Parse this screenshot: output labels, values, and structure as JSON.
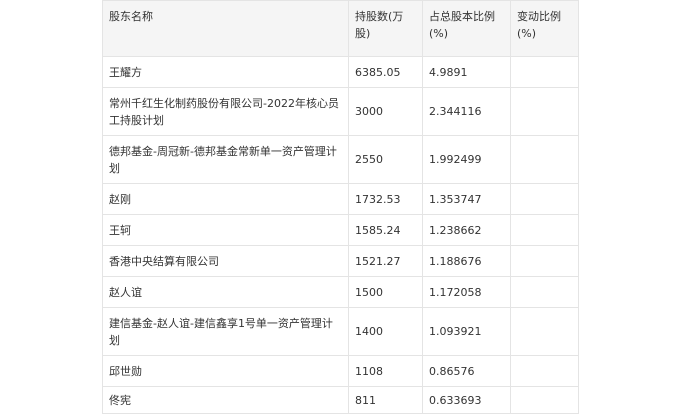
{
  "table": {
    "headers": [
      "股东名称",
      "持股数(万股)",
      "占总股本比例(%)",
      "变动比例(%)"
    ],
    "rows": [
      {
        "name": "王耀方",
        "shares": "6385.05",
        "ratio": "4.9891",
        "change": ""
      },
      {
        "name": "常州千红生化制药股份有限公司-2022年核心员工持股计划",
        "shares": "3000",
        "ratio": "2.344116",
        "change": ""
      },
      {
        "name": "德邦基金-周冠新-德邦基金常新单一资产管理计划",
        "shares": "2550",
        "ratio": "1.992499",
        "change": ""
      },
      {
        "name": "赵刚",
        "shares": "1732.53",
        "ratio": "1.353747",
        "change": ""
      },
      {
        "name": "王轲",
        "shares": "1585.24",
        "ratio": "1.238662",
        "change": ""
      },
      {
        "name": "香港中央结算有限公司",
        "shares": "1521.27",
        "ratio": "1.188676",
        "change": ""
      },
      {
        "name": "赵人谊",
        "shares": "1500",
        "ratio": "1.172058",
        "change": ""
      },
      {
        "name": "建信基金-赵人谊-建信鑫享1号单一资产管理计划",
        "shares": "1400",
        "ratio": "1.093921",
        "change": ""
      },
      {
        "name": "邱世勋",
        "shares": "1108",
        "ratio": "0.86576",
        "change": ""
      },
      {
        "name": "佟宪",
        "shares": "811",
        "ratio": "0.633693",
        "change": ""
      }
    ]
  }
}
